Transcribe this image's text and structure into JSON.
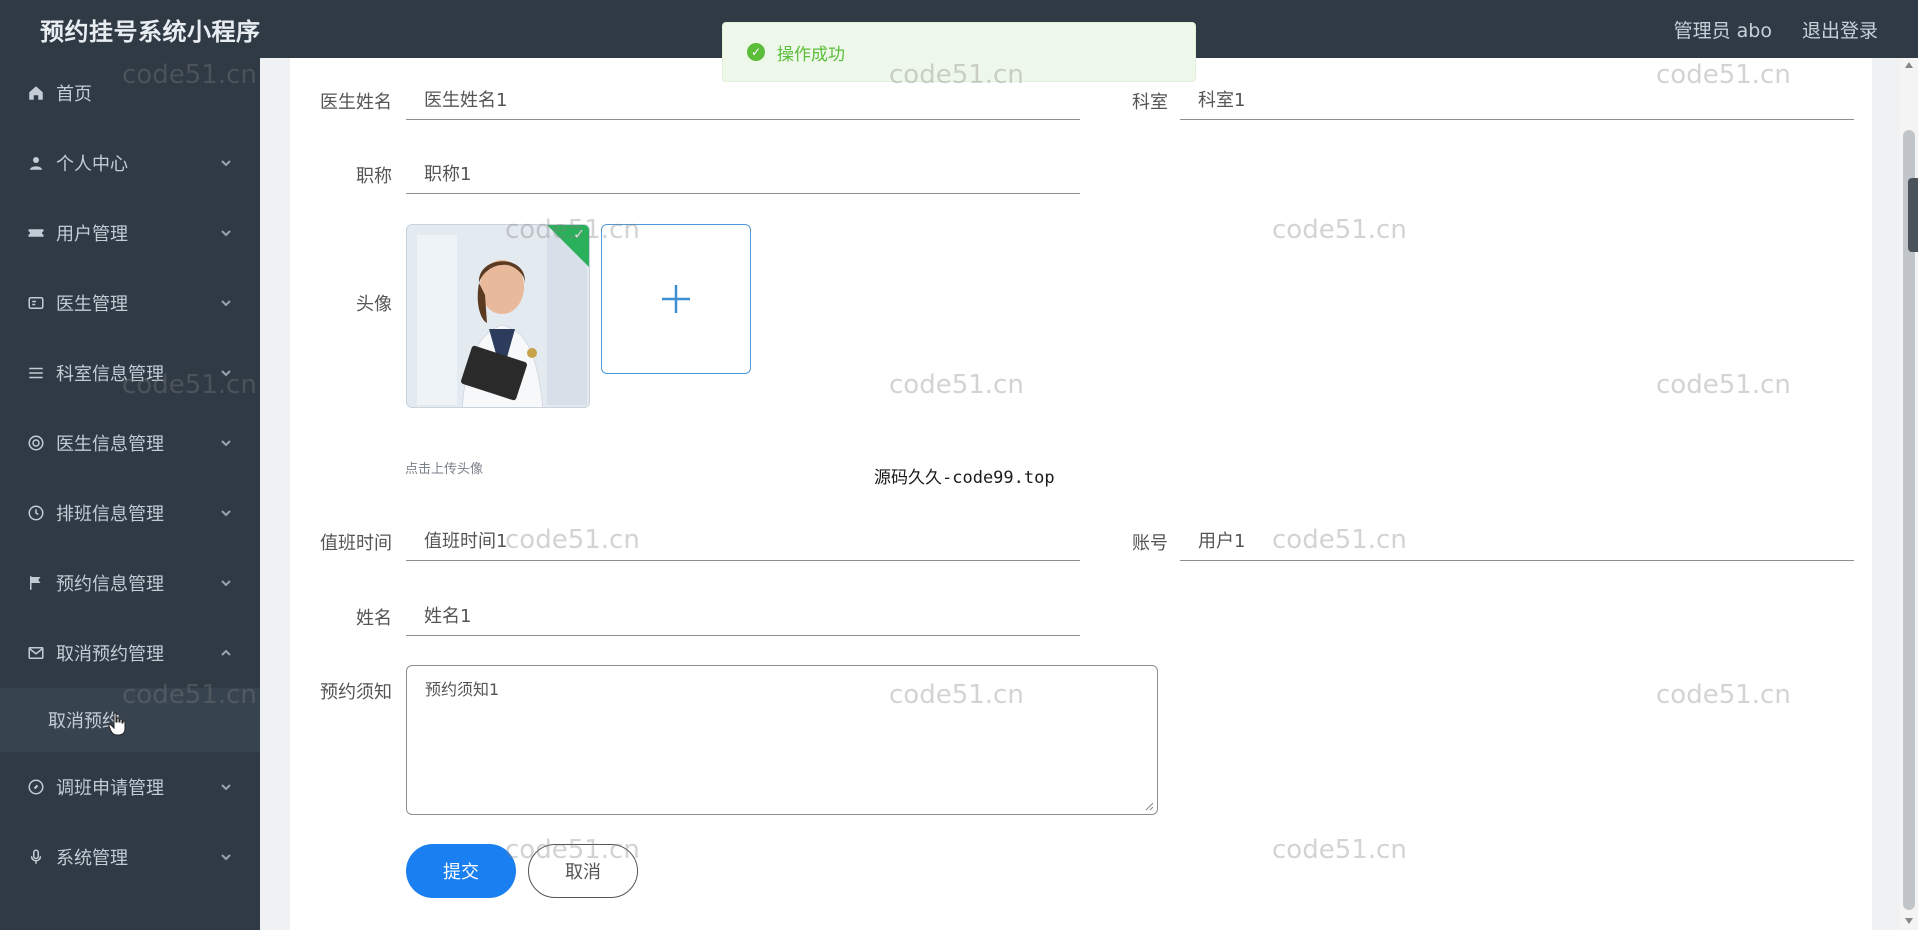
{
  "header": {
    "app_title": "预约挂号系统小程序",
    "user_label": "管理员 abo",
    "logout_label": "退出登录"
  },
  "sidebar": {
    "items": [
      {
        "label": "首页",
        "icon": "home-icon",
        "has_chevron": false
      },
      {
        "label": "个人中心",
        "icon": "user-icon",
        "has_chevron": true
      },
      {
        "label": "用户管理",
        "icon": "ticket-icon",
        "has_chevron": true
      },
      {
        "label": "医生管理",
        "icon": "id-card-icon",
        "has_chevron": true
      },
      {
        "label": "科室信息管理",
        "icon": "list-icon",
        "has_chevron": true
      },
      {
        "label": "医生信息管理",
        "icon": "lifebuoy-icon",
        "has_chevron": true
      },
      {
        "label": "排班信息管理",
        "icon": "clock-icon",
        "has_chevron": true
      },
      {
        "label": "预约信息管理",
        "icon": "flag-icon",
        "has_chevron": true
      },
      {
        "label": "取消预约管理",
        "icon": "mail-icon",
        "has_chevron": true,
        "expanded": true
      },
      {
        "label": "调班申请管理",
        "icon": "compass-icon",
        "has_chevron": true
      },
      {
        "label": "系统管理",
        "icon": "mic-icon",
        "has_chevron": true
      }
    ],
    "sub_item": "取消预约"
  },
  "toast": {
    "message": "操作成功",
    "color": "#5bbd3a"
  },
  "form": {
    "doctor_name_label": "医生姓名",
    "doctor_name_value": "医生姓名1",
    "department_label": "科室",
    "department_value": "科室1",
    "title_label": "职称",
    "title_value": "职称1",
    "avatar_label": "头像",
    "upload_hint": "点击上传头像",
    "duty_time_label": "值班时间",
    "duty_time_value": "值班时间1",
    "account_label": "账号",
    "account_value": "用户1",
    "name_label": "姓名",
    "name_value": "姓名1",
    "notice_label": "预约须知",
    "notice_value": "预约须知1",
    "submit_label": "提交",
    "cancel_label": "取消"
  },
  "overlay_text": "源码久久-code99.top",
  "watermark": "code51.cn",
  "colors": {
    "sidebar_bg": "#2f3a45",
    "primary": "#1a7ff0",
    "success": "#2ab05a"
  }
}
